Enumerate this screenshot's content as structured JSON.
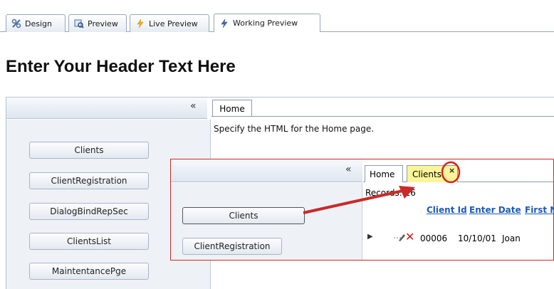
{
  "designer_tabs": [
    {
      "label": "Design",
      "icon": "design-icon"
    },
    {
      "label": "Preview",
      "icon": "preview-icon"
    },
    {
      "label": "Live Preview",
      "icon": "lightning-icon"
    },
    {
      "label": "Working Preview",
      "icon": "lightning-icon"
    }
  ],
  "header": {
    "title": "Enter Your Header Text Here"
  },
  "sidebar": {
    "collapse_glyph": "«",
    "items": [
      "Clients",
      "ClientRegistration",
      "DialogBindRepSec",
      "ClientsList",
      "MaintentancePge"
    ]
  },
  "main": {
    "tab_label": "Home",
    "content": "Specify the HTML for the Home page."
  },
  "inset": {
    "collapse_glyph": "«",
    "items": [
      "Clients",
      "ClientRegistration"
    ],
    "tabs": [
      "Home",
      "Clients"
    ],
    "close_glyph": "×",
    "records_label": "Records:",
    "records_count": "26",
    "columns": [
      "Client Id",
      "Enter Date",
      "First N"
    ],
    "row": {
      "id": "00006",
      "date": "10/10/01",
      "first": "Joan"
    }
  },
  "colors": {
    "highlight_border": "#c92a2a",
    "tab_highlight": "#fbf59a",
    "link": "#1e5bb8"
  }
}
